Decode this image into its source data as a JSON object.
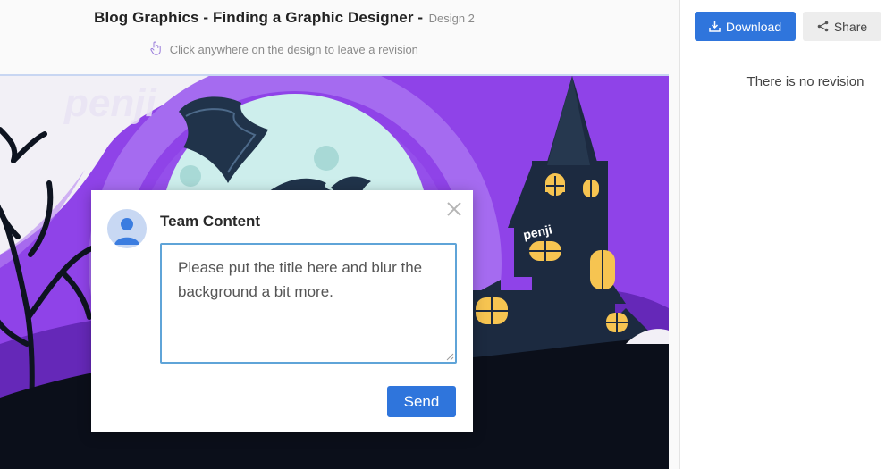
{
  "header": {
    "title": "Blog Graphics - Finding a Graphic Designer -",
    "design_label": "Design 2",
    "hint": "Click anywhere on the design to leave a revision"
  },
  "design": {
    "watermark": "penji",
    "sign_text": "penji",
    "colors": {
      "sky": "#8f43e8",
      "moon": "#cdeeec",
      "ground": "#0b0f1a",
      "window": "#f6c451"
    }
  },
  "comment_popup": {
    "author": "Team Content",
    "comment_text": "Please put the title here and blur the background a bit more.",
    "send_label": "Send",
    "close_icon": "close-icon",
    "annotation_color": "#e02424"
  },
  "toolbar": {
    "download_label": "Download",
    "share_label": "Share",
    "accent": "#2f75dc"
  },
  "revisions": {
    "empty_text": "There is no revision"
  }
}
